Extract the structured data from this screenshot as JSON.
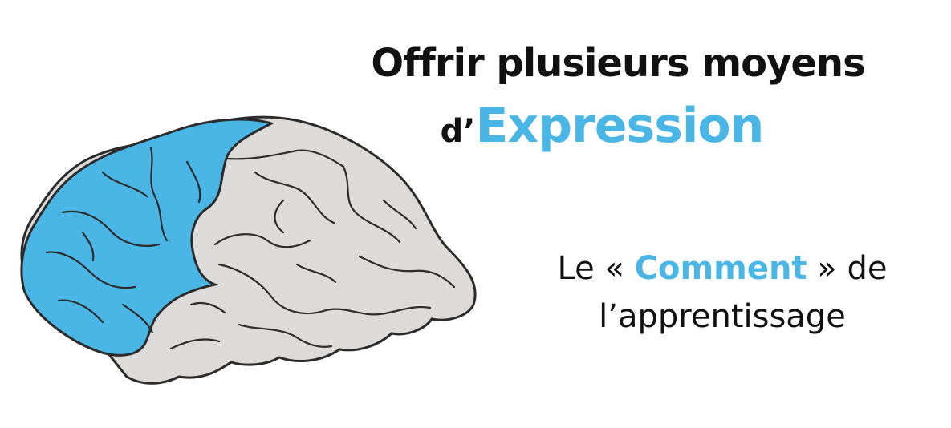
{
  "colors": {
    "accent": "#4ab6e6",
    "brain_fill": "#dcdbd9",
    "outline": "#2b2b2b",
    "text": "#111111"
  },
  "icons": {
    "brain": "brain-illustration-icon"
  },
  "title": {
    "line1": "Offrir plusieurs moyens",
    "prefix": "d’",
    "highlight": "Expression"
  },
  "subtitle": {
    "part1": "Le « ",
    "highlight": "Comment",
    "part2": " » de",
    "line2": "l’apprentissage"
  }
}
